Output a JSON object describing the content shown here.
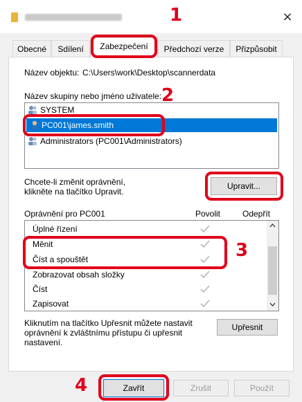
{
  "window": {
    "close_glyph": "×",
    "icon": "folder-icon"
  },
  "steps": {
    "s1": "1",
    "s2": "2",
    "s3": "3",
    "s4": "4"
  },
  "tabs": [
    {
      "label": "Obecné"
    },
    {
      "label": "Sdílení"
    },
    {
      "label": "Zabezpečení",
      "active": true
    },
    {
      "label": "Předchozí verze"
    },
    {
      "label": "Přizpůsobit"
    }
  ],
  "object": {
    "label": "Název objektu:",
    "path": "C:\\Users\\work\\Desktop\\scannerdata"
  },
  "groups": {
    "heading": "Název skupiny nebo jméno uživatele:",
    "items": [
      {
        "name": "SYSTEM"
      },
      {
        "name": "PC001\\james.smith",
        "selected": true
      },
      {
        "name": "Administrators (PC001\\Administrators)"
      }
    ]
  },
  "change": {
    "line1": "Chcete-li změnit oprávnění,",
    "line2": "klikněte na tlačítko Upravit.",
    "button": "Upravit..."
  },
  "permissions": {
    "heading": "Oprávnění pro PC001",
    "allow_label": "Povolit",
    "deny_label": "Odepřít",
    "rows": [
      {
        "name": "Úplné řízení",
        "allow": true
      },
      {
        "name": "Měnit",
        "allow": true
      },
      {
        "name": "Číst a spouštět",
        "allow": true
      },
      {
        "name": "Zobrazovat obsah složky",
        "allow": true
      },
      {
        "name": "Číst",
        "allow": true
      },
      {
        "name": "Zapisovat",
        "allow": true
      }
    ]
  },
  "advanced": {
    "line1": "Kliknutím na tlačítko Upřesnit můžete nastavit",
    "line2": "oprávnění k zvláštnímu přístupu či upřesnit",
    "line3": "nastavení.",
    "button": "Upřesnit"
  },
  "footer": {
    "close": "Zavřít",
    "cancel": "Zrušit",
    "apply": "Použít"
  },
  "colors": {
    "accent": "#e0001b",
    "selection": "#0078d7"
  }
}
